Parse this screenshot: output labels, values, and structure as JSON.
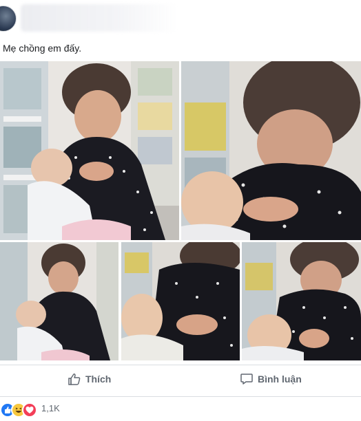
{
  "post": {
    "caption": "Mẹ chồng em đấy.",
    "photos": [
      {
        "name": "photo-grandmother-feeding-baby-1"
      },
      {
        "name": "photo-grandmother-feeding-baby-2"
      },
      {
        "name": "photo-grandmother-feeding-baby-3"
      },
      {
        "name": "photo-grandmother-feeding-baby-4"
      },
      {
        "name": "photo-grandmother-feeding-baby-5"
      }
    ]
  },
  "actions": {
    "like_label": "Thích",
    "comment_label": "Bình luận"
  },
  "reactions": {
    "icons": [
      "like-reaction-icon",
      "haha-reaction-icon",
      "love-reaction-icon"
    ],
    "count": "1,1K"
  },
  "colors": {
    "like_blue": "#2078f4",
    "haha_yellow": "#f7c83f",
    "love_red": "#f33e58",
    "action_grey": "#606770"
  }
}
